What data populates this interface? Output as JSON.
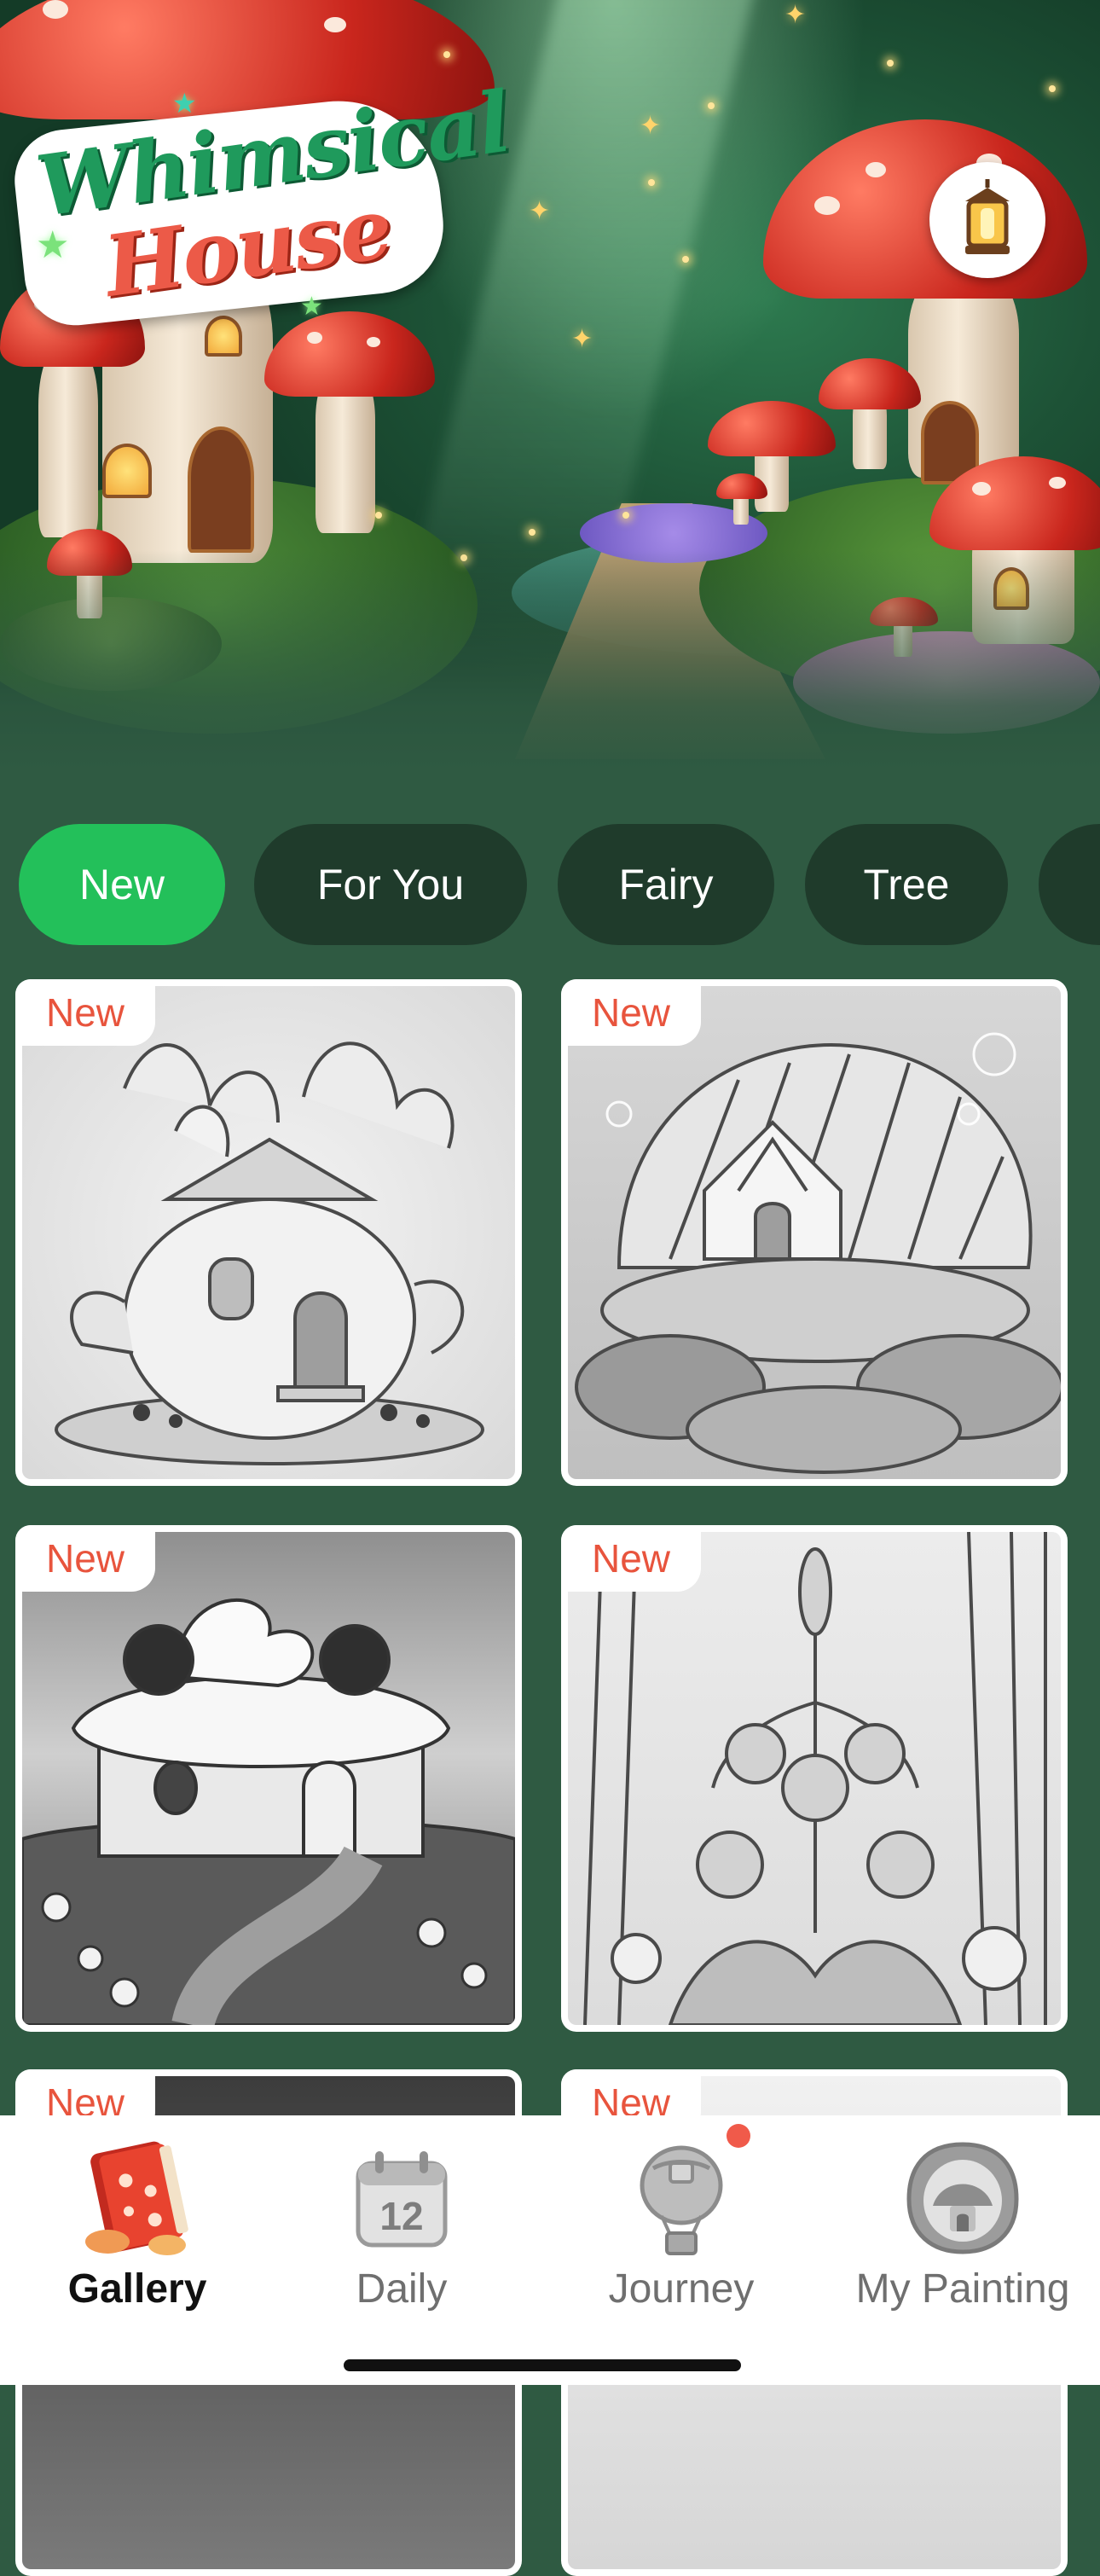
{
  "hero": {
    "logo_line1": "Whimsical",
    "logo_line2": "House",
    "lantern_icon": "lantern-icon"
  },
  "categories": [
    {
      "label": "New",
      "active": true
    },
    {
      "label": "For You",
      "active": false
    },
    {
      "label": "Fairy",
      "active": false
    },
    {
      "label": "Tree",
      "active": false
    }
  ],
  "gallery": {
    "items": [
      {
        "badge": "New",
        "subject": "teapot-flower-house"
      },
      {
        "badge": "New",
        "subject": "seashell-house"
      },
      {
        "badge": "New",
        "subject": "cupcake-house"
      },
      {
        "badge": "New",
        "subject": "lavender-lantern-tree"
      },
      {
        "badge": "New",
        "subject": "partial"
      },
      {
        "badge": "New",
        "subject": "partial"
      }
    ]
  },
  "bottom_nav": [
    {
      "label": "Gallery",
      "icon": "book-icon",
      "active": true
    },
    {
      "label": "Daily",
      "icon": "calendar-icon",
      "active": false,
      "calendar_day": "12"
    },
    {
      "label": "Journey",
      "icon": "balloon-icon",
      "active": false,
      "has_notification": true
    },
    {
      "label": "My Painting",
      "icon": "picture-frame-icon",
      "active": false
    }
  ],
  "colors": {
    "background": "#2f5a42",
    "tab_active": "#23c05a",
    "tab_inactive": "#1f3b2b",
    "badge_text": "#e8543d",
    "notification": "#f05a4a"
  }
}
